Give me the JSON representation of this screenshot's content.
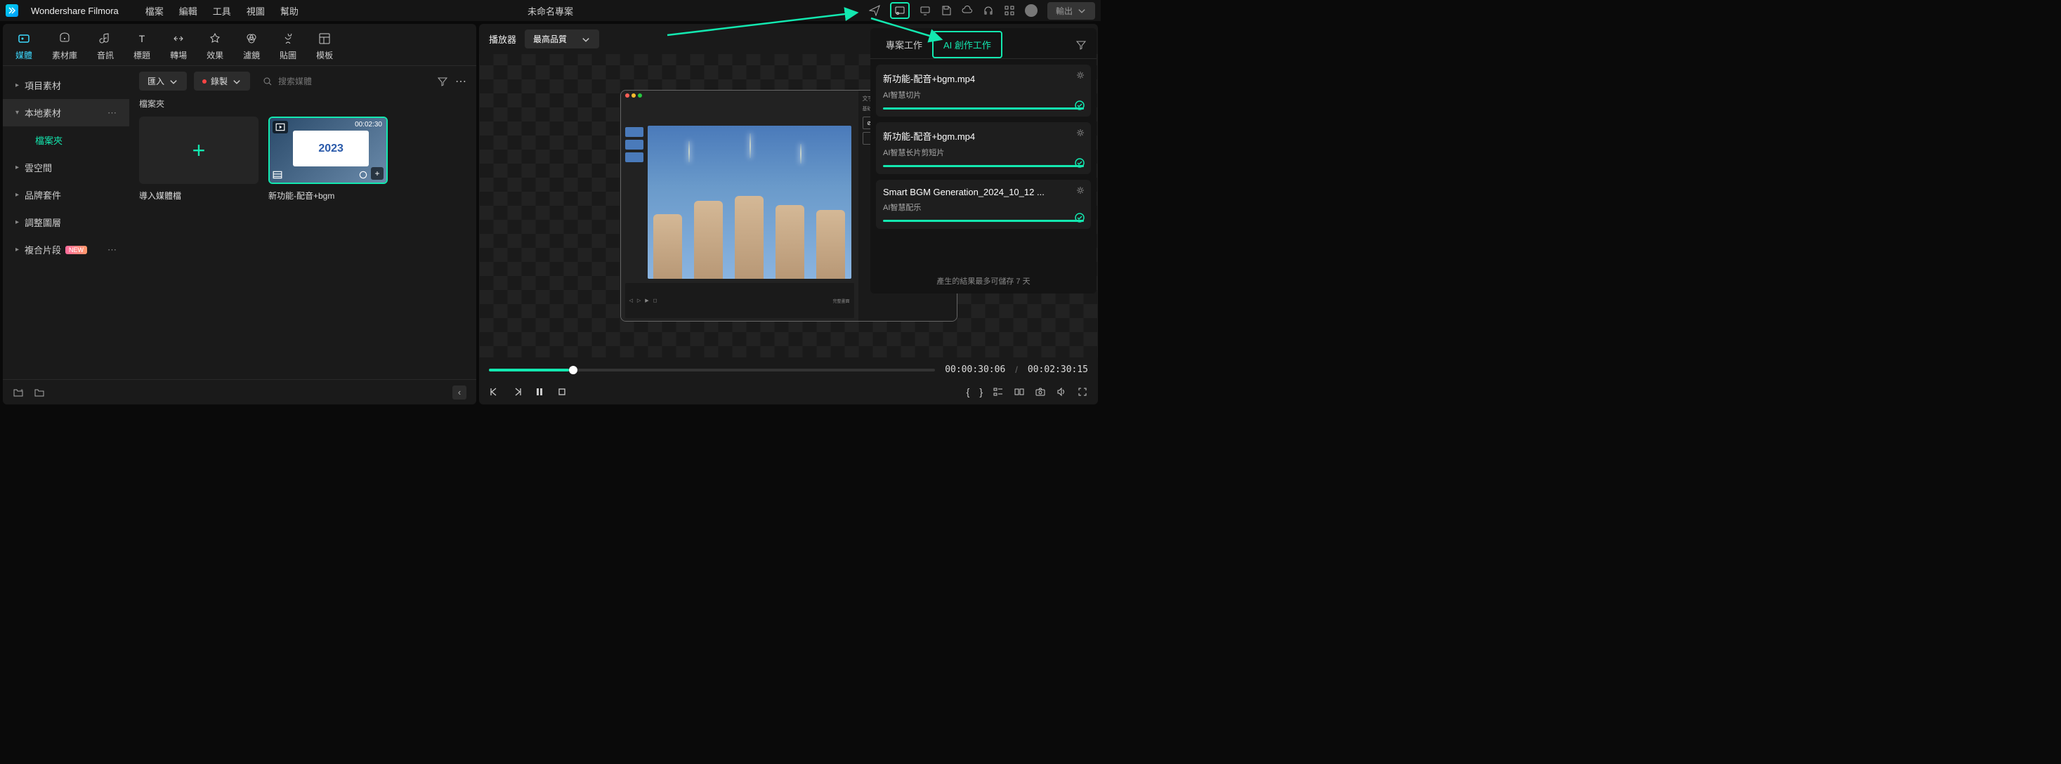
{
  "app": {
    "title": "Wondershare Filmora",
    "project": "未命名專案",
    "export": "輸出"
  },
  "menu": [
    "檔案",
    "編輯",
    "工具",
    "視圖",
    "幫助"
  ],
  "toolTabs": [
    {
      "label": "媒體"
    },
    {
      "label": "素材庫"
    },
    {
      "label": "音訊"
    },
    {
      "label": "標題"
    },
    {
      "label": "轉場"
    },
    {
      "label": "效果"
    },
    {
      "label": "濾鏡"
    },
    {
      "label": "貼圖"
    },
    {
      "label": "模板"
    }
  ],
  "mediaToolbar": {
    "import": "匯入",
    "record": "錄製",
    "searchPlaceholder": "搜索媒體"
  },
  "sidebar": {
    "items": [
      {
        "label": "項目素材"
      },
      {
        "label": "本地素材",
        "sub": "檔案夾"
      },
      {
        "label": "雲空間"
      },
      {
        "label": "品牌套件"
      },
      {
        "label": "調整圖層"
      },
      {
        "label": "複合片段",
        "badge": "NEW"
      }
    ]
  },
  "mediaSection": {
    "label": "檔案夾",
    "importLabel": "導入媒體檔",
    "clipName": "新功能-配音+bgm",
    "clipDur": "00:02:30"
  },
  "player": {
    "label": "播放器",
    "quality": "最高品質",
    "current": "00:00:30:06",
    "total": "00:02:30:15"
  },
  "aiPanel": {
    "tabs": [
      "專案工作",
      "AI 創作工作"
    ],
    "tasks": [
      {
        "title": "新功能-配音+bgm.mp4",
        "sub": "AI智慧切片"
      },
      {
        "title": "新功能-配音+bgm.mp4",
        "sub": "AI智慧长片剪短片"
      },
      {
        "title": "Smart BGM Generation_2024_10_12 ...",
        "sub": "AI智慧配乐"
      }
    ],
    "footer": "產生的結果最多可儲存 7 天"
  }
}
